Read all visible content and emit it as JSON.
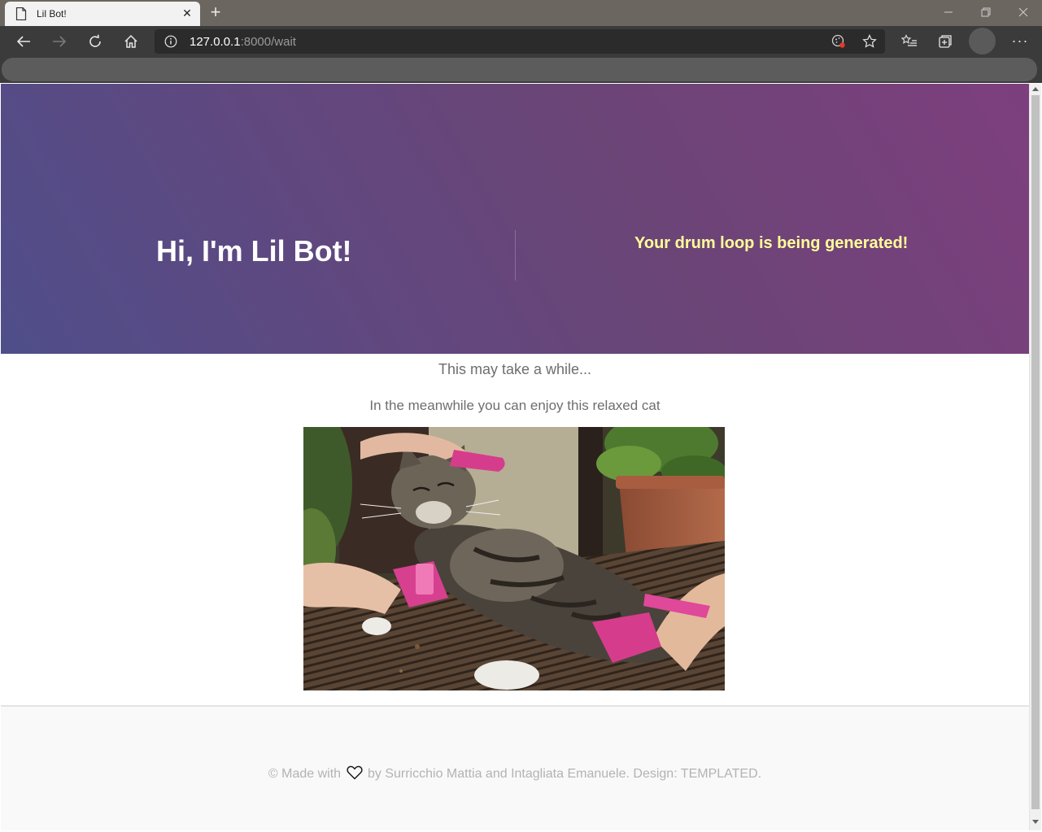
{
  "browser": {
    "tab_title": "Lil Bot!",
    "tab_close": "✕",
    "new_tab": "+",
    "address_host": "127.0.0.1",
    "address_path": ":8000/wait",
    "more": "···"
  },
  "hero": {
    "title": "Hi, I'm Lil Bot!",
    "status": "Your drum loop is being generated!",
    "status_color": "#ffff99",
    "gradient_colors": [
      "#4f4e8a",
      "#7d3f7e"
    ]
  },
  "content": {
    "message": "This may take a while...",
    "submessage": "In the meanwhile you can enjoy this relaxed cat"
  },
  "footer": {
    "prefix": "© Made with",
    "suffix": "by Surricchio Mattia and Intagliata Emanuele. Design: TEMPLATED."
  }
}
